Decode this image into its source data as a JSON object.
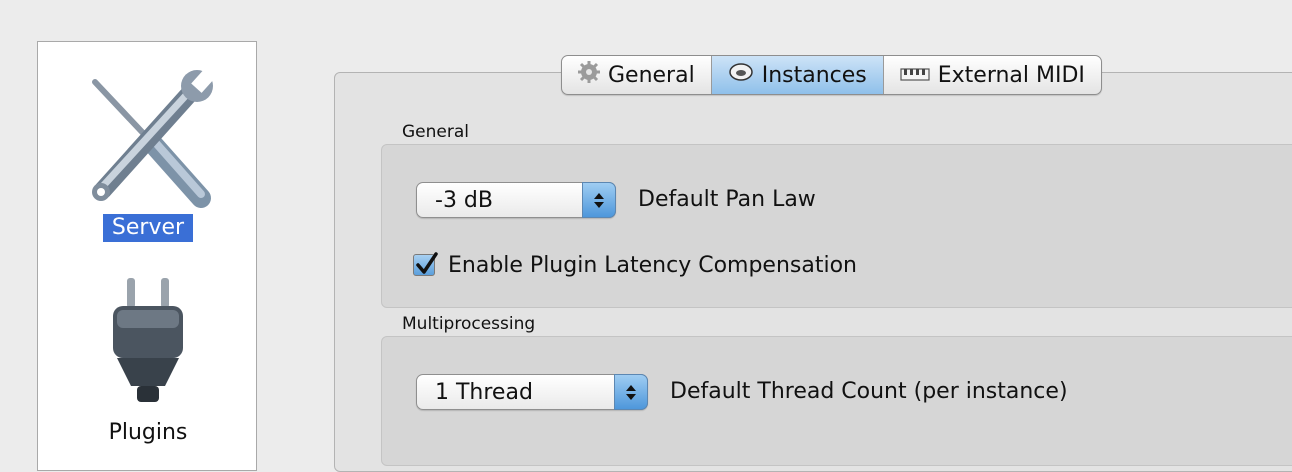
{
  "sidebar": {
    "items": [
      {
        "label": "Server",
        "icon": "tools-icon",
        "selected": true
      },
      {
        "label": "Plugins",
        "icon": "plug-icon",
        "selected": false
      }
    ]
  },
  "tabs": [
    {
      "label": "General",
      "icon": "gear-icon",
      "active": false
    },
    {
      "label": "Instances",
      "icon": "ring-icon",
      "active": true
    },
    {
      "label": "External MIDI",
      "icon": "midi-keyboard-icon",
      "active": false
    }
  ],
  "general_group": {
    "title": "General",
    "pan_law": {
      "value": "-3 dB",
      "label": "Default Pan Law"
    },
    "latency": {
      "label": "Enable Plugin Latency Compensation",
      "checked": true
    }
  },
  "multiprocessing_group": {
    "title": "Multiprocessing",
    "thread_count": {
      "value": "1 Thread",
      "label": "Default Thread Count (per instance)"
    }
  },
  "colors": {
    "selection": "#3a6fd6",
    "active_tab": "#8fc0ea",
    "accent": "#4e97db"
  }
}
